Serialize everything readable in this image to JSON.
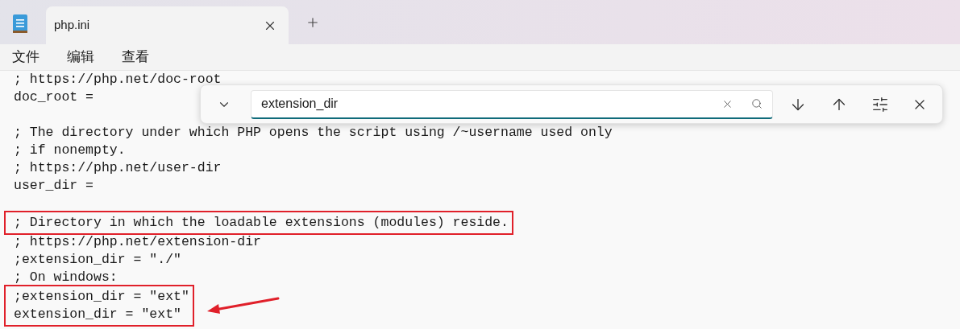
{
  "window": {
    "tab": {
      "title": "php.ini",
      "selected": true
    }
  },
  "menu": [
    "文件",
    "编辑",
    "查看"
  ],
  "find": {
    "value": "extension_dir"
  },
  "blocks": [
    {
      "boxed": false,
      "arrow": false,
      "lines": [
        {
          "kind": "text",
          "text": "; https://php.net/doc-root"
        },
        {
          "kind": "text",
          "text": "doc_root ="
        },
        {
          "kind": "blank"
        },
        {
          "kind": "text",
          "text": "; The directory under which PHP opens the script using /~username used only"
        },
        {
          "kind": "text",
          "text": "; if nonempty."
        },
        {
          "kind": "text",
          "text": "; https://php.net/user-dir"
        },
        {
          "kind": "text",
          "text": "user_dir ="
        },
        {
          "kind": "blank"
        }
      ]
    },
    {
      "boxed": true,
      "arrow": false,
      "lines": [
        {
          "kind": "text",
          "text": "; Directory in which the loadable extensions (modules) reside."
        }
      ]
    },
    {
      "boxed": false,
      "arrow": false,
      "lines": [
        {
          "kind": "text",
          "text": "; https://php.net/extension-dir"
        },
        {
          "kind": "text",
          "text": ";extension_dir = \"./\""
        },
        {
          "kind": "text",
          "text": "; On windows:"
        }
      ]
    },
    {
      "boxed": true,
      "arrow": true,
      "lines": [
        {
          "kind": "text",
          "text": ";extension_dir = \"ext\""
        },
        {
          "kind": "text",
          "text": "extension_dir = \"ext\""
        }
      ]
    }
  ]
}
